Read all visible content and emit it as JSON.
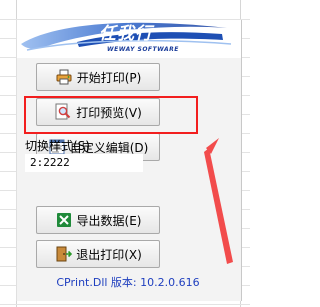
{
  "branding": {
    "cn_name": "任我行",
    "en_name": "WEWAY SOFTWARE"
  },
  "buttons": {
    "start_print": "开始打印(P)",
    "print_preview": "打印预览(V)",
    "custom_edit": "自定义编辑(D)",
    "export_data": "导出数据(E)",
    "exit_print": "退出打印(X)"
  },
  "style_switch": {
    "label": "切换样式(S)",
    "value": "2:2222"
  },
  "version_text": "CPrint.Dll 版本: 10.2.0.616",
  "colors": {
    "highlight": "#f21e1e",
    "version_text": "#1f3fbf",
    "banner_blue": "#1e4fb4"
  }
}
